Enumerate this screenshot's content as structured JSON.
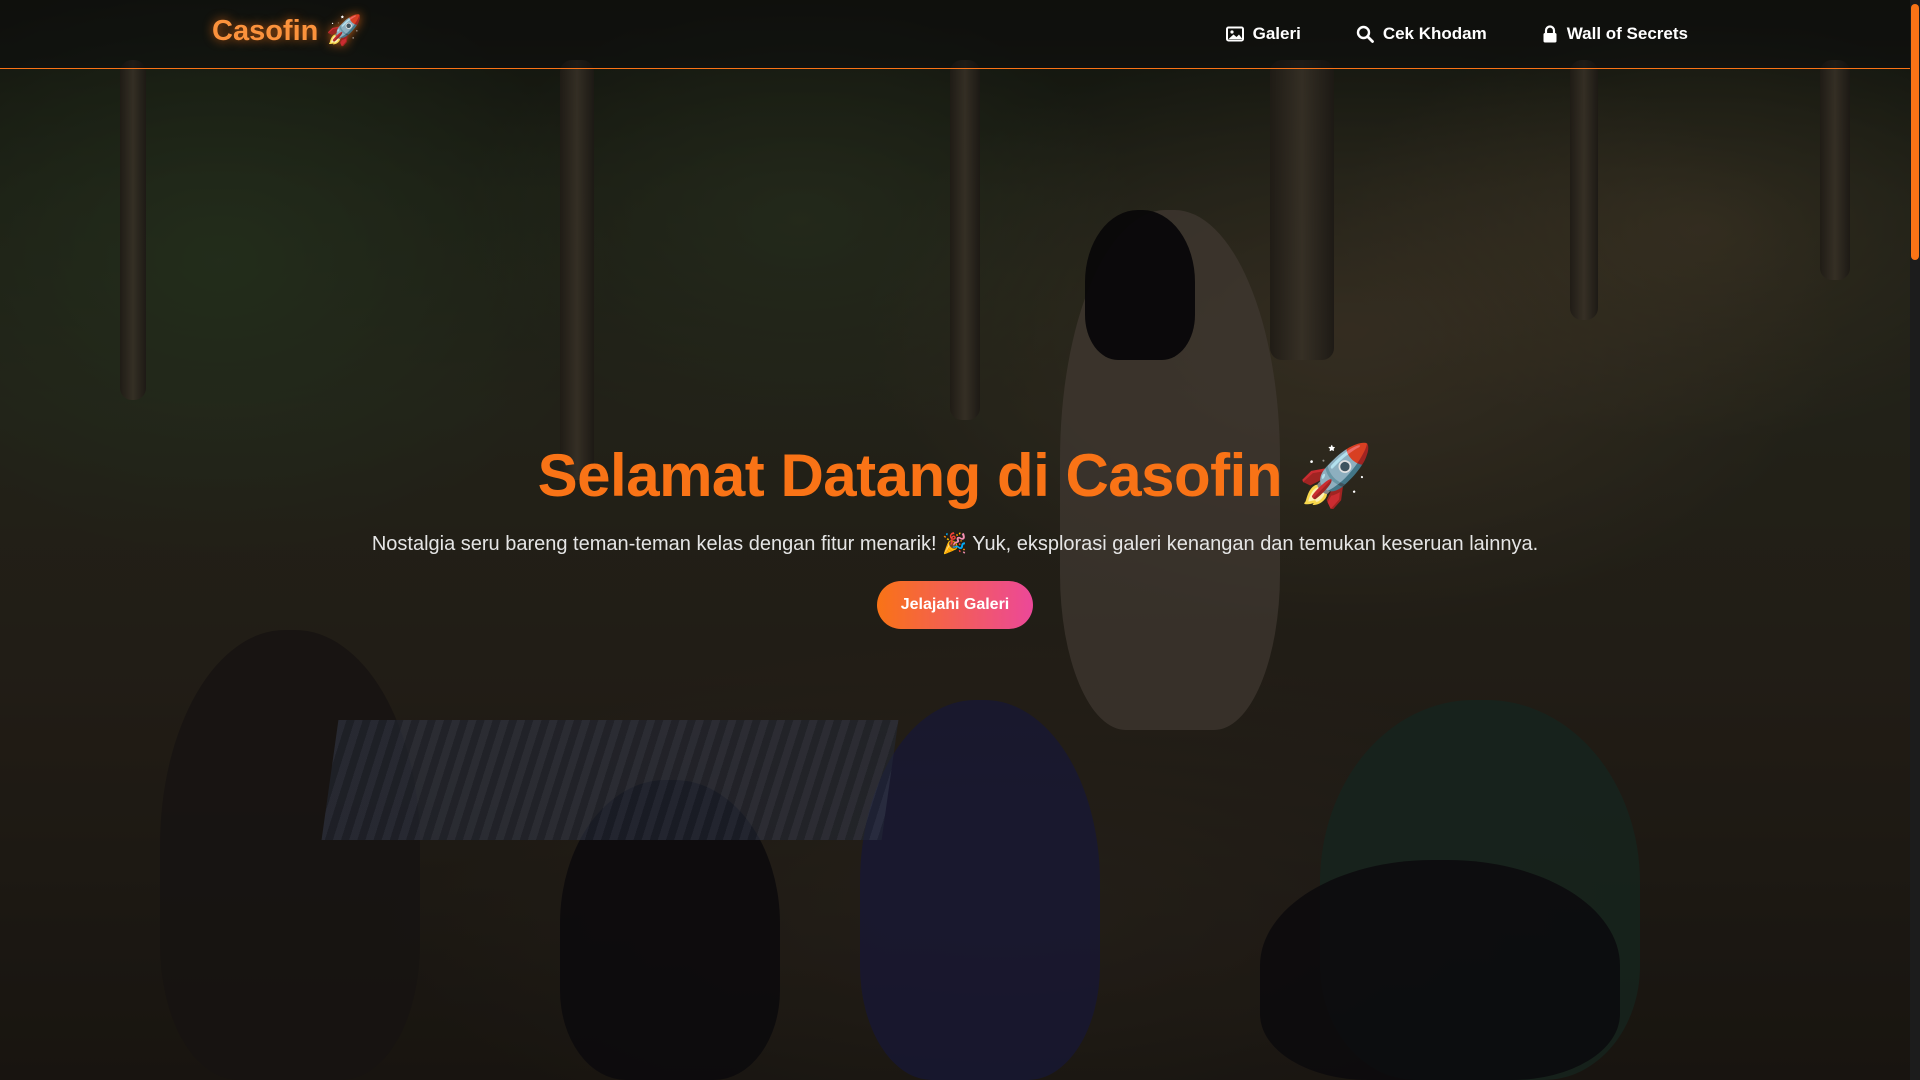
{
  "navbar": {
    "brand": "Casofin 🚀",
    "links": [
      {
        "label": "Galeri",
        "icon": "image-icon"
      },
      {
        "label": "Cek Khodam",
        "icon": "search-icon"
      },
      {
        "label": "Wall of Secrets",
        "icon": "lock-icon"
      }
    ]
  },
  "hero": {
    "title": "Selamat Datang di Casofin 🚀",
    "subtitle": "Nostalgia seru bareng teman-teman kelas dengan fitur menarik! 🎉 Yuk, eksplorasi galeri kenangan dan temukan keseruan lainnya.",
    "cta_label": "Jelajahi Galeri",
    "background": "photo-of-classmates-picnic-in-forest"
  },
  "colors": {
    "accent": "#f97316",
    "gradient_end": "#ec4899",
    "scroll_thumb": "#f97316"
  }
}
